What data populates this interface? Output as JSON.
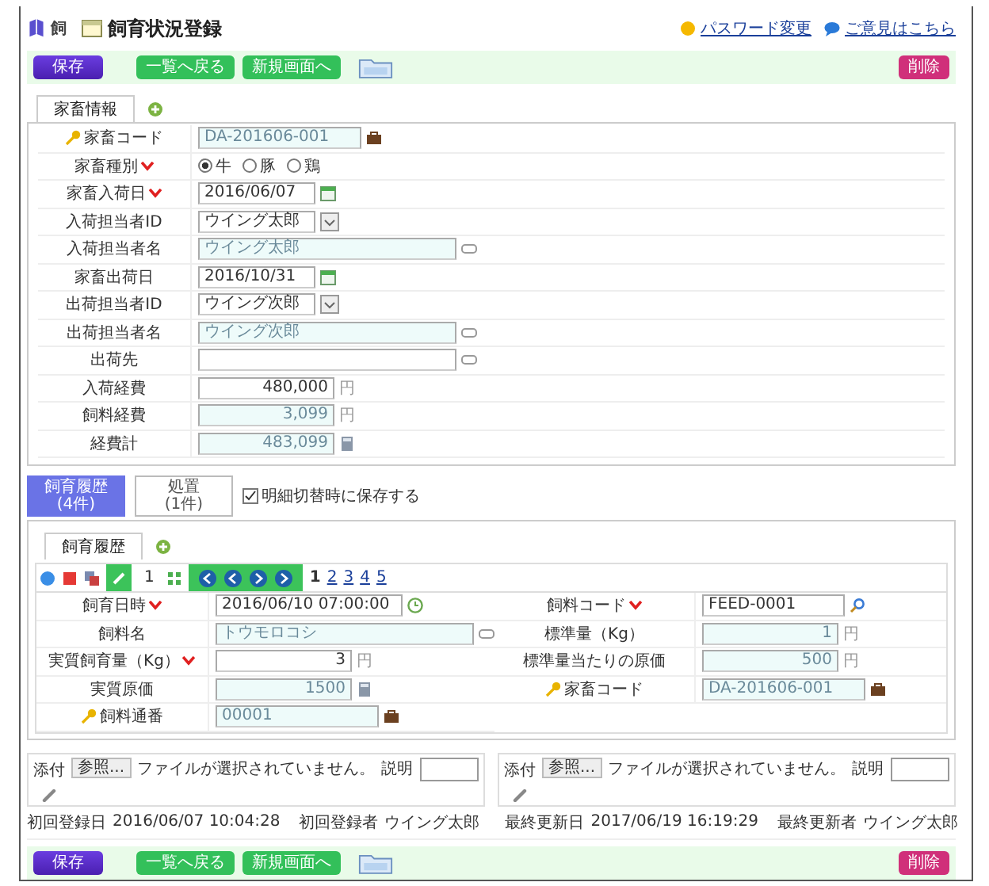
{
  "header": {
    "app": "飼",
    "title": "飼育状況登録",
    "links": [
      {
        "label": "パスワード変更",
        "kind": "smile"
      },
      {
        "label": "ご意見はこちら",
        "kind": "bubble"
      }
    ]
  },
  "toolbar_top": {
    "buttons": [
      {
        "label": "保存",
        "kind": "primary"
      },
      {
        "label": "一覧へ戻る",
        "kind": "green"
      },
      {
        "label": "新規画面へ",
        "kind": "green"
      },
      {
        "label": "削除",
        "kind": "danger"
      }
    ]
  },
  "main_tabs": [
    {
      "label": "家畜情報",
      "selected": true
    }
  ],
  "form": {
    "rows": [
      {
        "label": "家畜コード",
        "key": true,
        "required": false,
        "kind": "code",
        "value": "DA-201606-001",
        "readonly": true
      },
      {
        "label": "家畜種別",
        "key": false,
        "required": true,
        "kind": "radio",
        "options": [
          {
            "label": "牛",
            "selected": true
          },
          {
            "label": "豚",
            "selected": false
          },
          {
            "label": "鶏",
            "selected": false
          }
        ]
      },
      {
        "label": "家畜入荷日",
        "key": false,
        "required": true,
        "kind": "date",
        "value": "2016/06/07",
        "readonly": false
      },
      {
        "label": "入荷担当者ID",
        "key": false,
        "required": false,
        "kind": "select",
        "value": "ウイング太郎",
        "readonly": false
      },
      {
        "label": "入荷担当者名",
        "key": false,
        "required": false,
        "kind": "name",
        "value": "ウイング太郎",
        "readonly": true
      },
      {
        "label": "家畜出荷日",
        "key": false,
        "required": false,
        "kind": "date",
        "value": "2016/10/31",
        "readonly": false
      },
      {
        "label": "出荷担当者ID",
        "key": false,
        "required": false,
        "kind": "select",
        "value": "ウイング次郎",
        "readonly": false
      },
      {
        "label": "出荷担当者名",
        "key": false,
        "required": false,
        "kind": "name",
        "value": "ウイング次郎",
        "readonly": true
      },
      {
        "label": "出荷先",
        "key": false,
        "required": false,
        "kind": "name",
        "value": "",
        "readonly": false
      },
      {
        "label": "入荷経費",
        "key": false,
        "required": false,
        "kind": "money",
        "value": "480,000",
        "unit": "円",
        "readonly": false
      },
      {
        "label": "飼料経費",
        "key": false,
        "required": false,
        "kind": "money",
        "value": "3,099",
        "unit": "円",
        "readonly": true
      },
      {
        "label": "経費計",
        "key": false,
        "required": false,
        "kind": "computed",
        "value": "483,099",
        "readonly": true
      }
    ]
  },
  "history_tabs": [
    {
      "title": "飼育履歴",
      "count": "(4件)",
      "selected": true
    },
    {
      "title": "処置",
      "count": "(1件)",
      "selected": false
    }
  ],
  "save_on_switch": {
    "label": "明細切替時に保存する",
    "checked": true
  },
  "sub_tabs": [
    {
      "label": "飼育履歴",
      "selected": true
    }
  ],
  "pager": {
    "current": "1",
    "pages": [
      {
        "label": "1",
        "selected": true
      },
      {
        "label": "2",
        "selected": false
      },
      {
        "label": "3",
        "selected": false
      },
      {
        "label": "4",
        "selected": false
      },
      {
        "label": "5",
        "selected": false
      }
    ]
  },
  "detail": {
    "left": [
      {
        "label": "飼育日時",
        "key": false,
        "required": true,
        "kind": "datetime",
        "value": "2016/06/10 07:00:00",
        "readonly": false
      },
      {
        "label": "飼料名",
        "key": false,
        "required": false,
        "kind": "name",
        "value": "トウモロコシ",
        "readonly": true
      },
      {
        "label": "実質飼育量（Kg）",
        "key": false,
        "required": true,
        "kind": "money",
        "value": "3",
        "unit": "円",
        "readonly": false
      },
      {
        "label": "実質原価",
        "key": false,
        "required": false,
        "kind": "computed",
        "value": "1500",
        "readonly": true
      },
      {
        "label": "飼料通番",
        "key": true,
        "required": false,
        "kind": "code",
        "value": "00001",
        "readonly": true
      }
    ],
    "right": [
      {
        "label": "飼料コード",
        "key": false,
        "required": true,
        "kind": "search",
        "value": "FEED-0001",
        "readonly": false
      },
      {
        "label": "標準量（Kg）",
        "key": false,
        "required": false,
        "kind": "money",
        "value": "1",
        "unit": "円",
        "readonly": true
      },
      {
        "label": "標準量当たりの原価",
        "key": false,
        "required": false,
        "kind": "money",
        "value": "500",
        "unit": "円",
        "readonly": true
      },
      {
        "label": "家畜コード",
        "key": true,
        "required": false,
        "kind": "code",
        "value": "DA-201606-001",
        "readonly": true
      }
    ]
  },
  "attachments": [
    {
      "label": "添付",
      "browse": "参照...",
      "status": "ファイルが選択されていません。",
      "desc_label": "説明"
    },
    {
      "label": "添付",
      "browse": "参照...",
      "status": "ファイルが選択されていません。",
      "desc_label": "説明"
    }
  ],
  "audit": [
    {
      "label": "初回登録日",
      "value": "2016/06/07 10:04:28"
    },
    {
      "label": "初回登録者",
      "value": "ウイング太郎"
    },
    {
      "label": "最終更新日",
      "value": "2017/06/19 16:19:29"
    },
    {
      "label": "最終更新者",
      "value": "ウイング太郎"
    }
  ],
  "toolbar_bottom": {
    "buttons": [
      {
        "label": "保存",
        "kind": "primary"
      },
      {
        "label": "一覧へ戻る",
        "kind": "green"
      },
      {
        "label": "新規画面へ",
        "kind": "green"
      },
      {
        "label": "削除",
        "kind": "danger"
      }
    ]
  }
}
